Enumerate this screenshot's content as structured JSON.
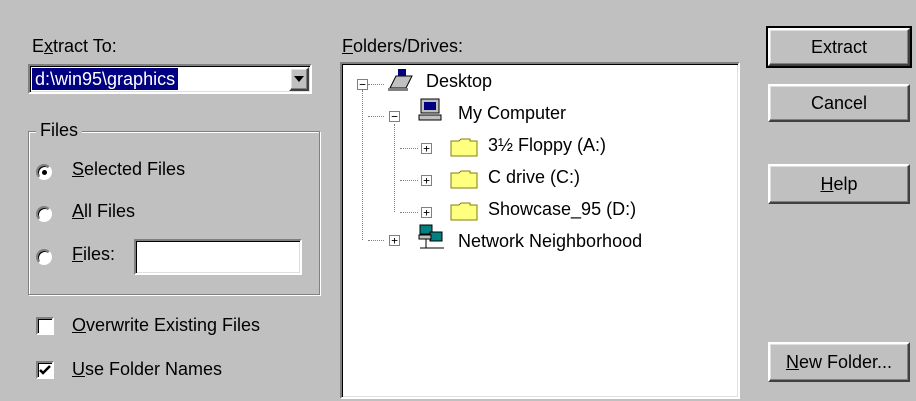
{
  "extract_to": {
    "label_pre": "E",
    "label_u": "x",
    "label_post": "tract To:",
    "value": "d:\\win95\\graphics"
  },
  "files_group": {
    "title": "Files",
    "selected_files": {
      "u": "S",
      "rest": "elected Files",
      "checked": true
    },
    "all_files": {
      "u": "A",
      "rest": "ll Files",
      "checked": false
    },
    "files": {
      "u": "F",
      "rest": "iles:",
      "checked": false,
      "value": ""
    }
  },
  "options": {
    "overwrite": {
      "u": "O",
      "rest": "verwrite Existing Files",
      "checked": false
    },
    "use_folder_names": {
      "u": "U",
      "rest": "se Folder Names",
      "checked": true
    }
  },
  "folders": {
    "label_u": "F",
    "label_rest": "olders/Drives:",
    "tree": {
      "desktop": "Desktop",
      "my_computer": "My Computer",
      "floppy": "3½ Floppy (A:)",
      "c_drive": "C drive (C:)",
      "showcase": "Showcase_95 (D:)",
      "network": "Network Neighborhood"
    }
  },
  "buttons": {
    "extract": "Extract",
    "cancel": "Cancel",
    "help_u": "H",
    "help_rest": "elp",
    "new_folder_u": "N",
    "new_folder_rest": "ew Folder..."
  },
  "colors": {
    "face": "#c0c0c0",
    "highlight": "#000080",
    "folder": "#ffff80"
  }
}
